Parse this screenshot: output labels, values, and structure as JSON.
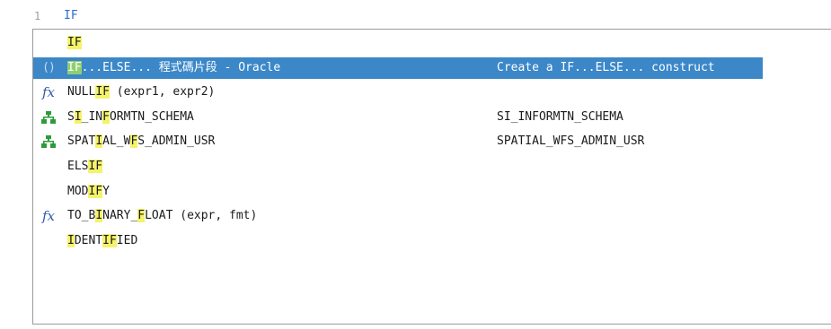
{
  "editor": {
    "line_number": "1",
    "code": "IF"
  },
  "autocomplete": {
    "items": [
      {
        "icon": "none",
        "parts": [
          {
            "t": "IF",
            "h": true
          }
        ],
        "desc": ""
      },
      {
        "icon": "paren-icon",
        "glyph": "()",
        "parts": [
          {
            "t": "IF",
            "h": true
          },
          {
            "t": "...ELSE... 程式碼片段 - Oracle",
            "h": false
          }
        ],
        "desc": "Create a IF...ELSE... construct",
        "selected": true
      },
      {
        "icon": "fx-icon",
        "glyph": "fx",
        "parts": [
          {
            "t": "NULL",
            "h": false
          },
          {
            "t": "IF",
            "h": true
          },
          {
            "t": " (expr1, expr2)",
            "h": false
          }
        ],
        "desc": ""
      },
      {
        "icon": "schema-icon",
        "parts": [
          {
            "t": "S",
            "h": false
          },
          {
            "t": "I",
            "h": true
          },
          {
            "t": "_IN",
            "h": false
          },
          {
            "t": "F",
            "h": true
          },
          {
            "t": "ORMTN_SCHEMA",
            "h": false
          }
        ],
        "desc": "SI_INFORMTN_SCHEMA"
      },
      {
        "icon": "schema-icon",
        "parts": [
          {
            "t": "SPAT",
            "h": false
          },
          {
            "t": "I",
            "h": true
          },
          {
            "t": "AL_W",
            "h": false
          },
          {
            "t": "F",
            "h": true
          },
          {
            "t": "S_ADMIN_USR",
            "h": false
          }
        ],
        "desc": "SPATIAL_WFS_ADMIN_USR"
      },
      {
        "icon": "none",
        "parts": [
          {
            "t": "ELS",
            "h": false
          },
          {
            "t": "IF",
            "h": true
          }
        ],
        "desc": ""
      },
      {
        "icon": "none",
        "parts": [
          {
            "t": "MOD",
            "h": false
          },
          {
            "t": "IF",
            "h": true
          },
          {
            "t": "Y",
            "h": false
          }
        ],
        "desc": ""
      },
      {
        "icon": "fx-icon",
        "glyph": "fx",
        "parts": [
          {
            "t": "TO_B",
            "h": false
          },
          {
            "t": "I",
            "h": true
          },
          {
            "t": "NARY_",
            "h": false
          },
          {
            "t": "F",
            "h": true
          },
          {
            "t": "LOAT (expr, fmt)",
            "h": false
          }
        ],
        "desc": ""
      },
      {
        "icon": "none",
        "parts": [
          {
            "t": "I",
            "h": true
          },
          {
            "t": "DENT",
            "h": false
          },
          {
            "t": "IF",
            "h": true
          },
          {
            "t": "IED",
            "h": false
          }
        ],
        "desc": ""
      }
    ]
  },
  "colors": {
    "selection": "#3b87c8",
    "match_highlight": "#f4f36a",
    "selected_match": "#8fcf6f",
    "schema_icon": "#2e9b3b"
  }
}
